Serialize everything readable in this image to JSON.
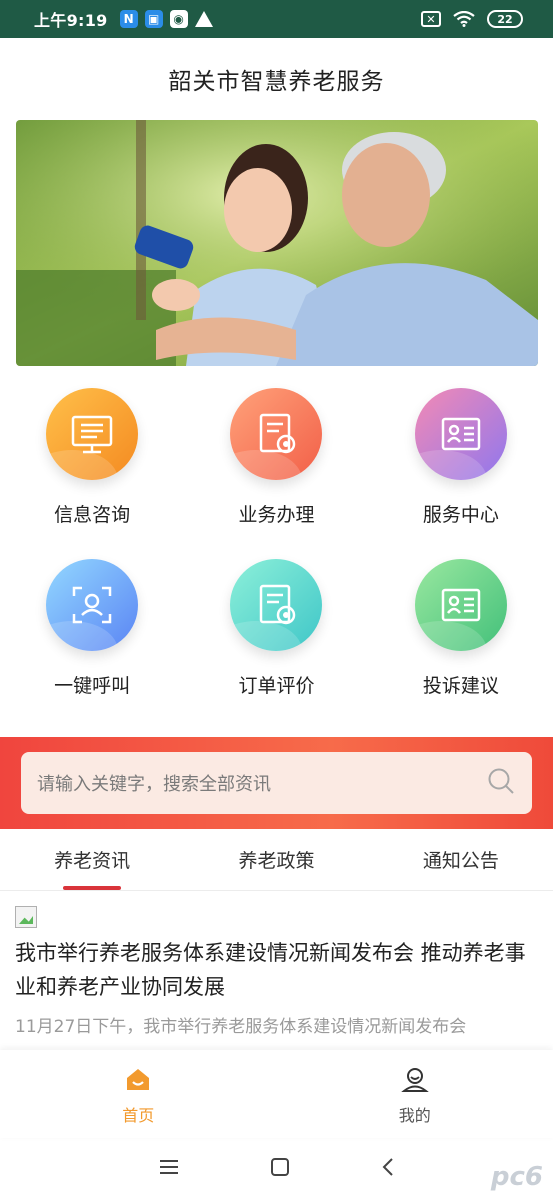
{
  "status_bar": {
    "time": "上午9:19",
    "battery": "22",
    "left_icons": [
      "n-app-icon",
      "chat-app-icon",
      "browser-app-icon",
      "warning-icon"
    ],
    "right_icons": [
      "sim-disabled-icon",
      "wifi-icon",
      "battery-icon"
    ]
  },
  "header": {
    "title": "韶关市智慧养老服务"
  },
  "banner": {
    "subject": "caregiver-with-elderly-man-photo"
  },
  "services": [
    {
      "label": "信息咨询",
      "icon": "monitor-list-icon"
    },
    {
      "label": "业务办理",
      "icon": "document-badge-icon"
    },
    {
      "label": "服务中心",
      "icon": "id-card-icon"
    },
    {
      "label": "一键呼叫",
      "icon": "face-scan-icon"
    },
    {
      "label": "订单评价",
      "icon": "document-badge-icon"
    },
    {
      "label": "投诉建议",
      "icon": "id-card-icon"
    }
  ],
  "search": {
    "placeholder": "请输入关键字，搜索全部资讯"
  },
  "tabs": [
    {
      "label": "养老资讯",
      "active": true
    },
    {
      "label": "养老政策",
      "active": false
    },
    {
      "label": "通知公告",
      "active": false
    }
  ],
  "news": {
    "title": "我市举行养老服务体系建设情况新闻发布会 推动养老事业和养老产业协同发展",
    "summary": "11月27日下午，我市举行养老服务体系建设情况新闻发布会"
  },
  "bottom_nav": [
    {
      "label": "首页",
      "active": true,
      "icon": "home-icon"
    },
    {
      "label": "我的",
      "active": false,
      "icon": "user-icon"
    }
  ],
  "system_nav": [
    "menu-icon",
    "home-square-icon",
    "back-icon"
  ],
  "watermark": "pc6",
  "colors": {
    "status_bar": "#1f5a45",
    "accent": "#f29a2e",
    "search_band": "#f0453e",
    "tab_indicator": "#d9343a"
  }
}
